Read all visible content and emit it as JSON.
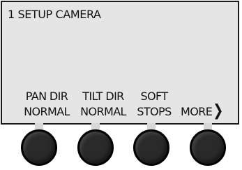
{
  "screen": {
    "title": "1 SETUP CAMERA"
  },
  "softkeys": [
    {
      "line1": "PAN DIR",
      "line2": "NORMAL"
    },
    {
      "line1": "TILT DIR",
      "line2": "NORMAL"
    },
    {
      "line1": "SOFT",
      "line2": "STOPS"
    },
    {
      "label": "MORE",
      "arrow": "❯"
    }
  ],
  "colors": {
    "lcd_background": "#e5e5e5",
    "knob": "#2a2a2a"
  }
}
